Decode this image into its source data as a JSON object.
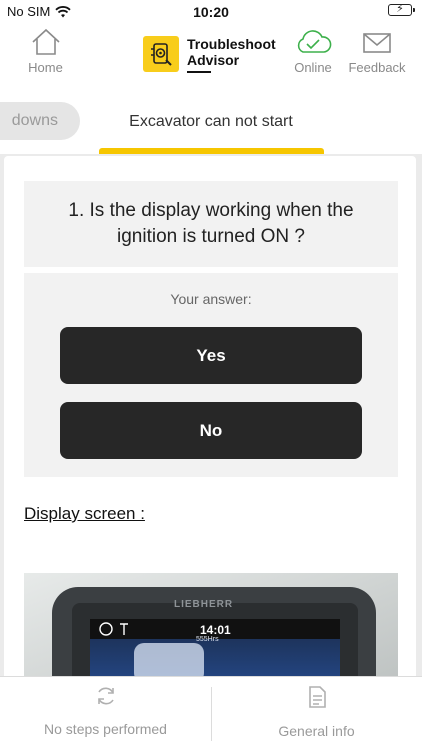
{
  "status_bar": {
    "carrier": "No SIM",
    "time": "10:20",
    "wifi_icon": "wifi-icon",
    "battery_icon": "battery-charging-icon"
  },
  "header": {
    "home_label": "Home",
    "home_icon": "home-icon",
    "logo_line1": "Troubleshoot",
    "logo_line2": "Advisor",
    "online_label": "Online",
    "online_icon": "cloud-check-icon",
    "feedback_label": "Feedback",
    "feedback_icon": "envelope-icon",
    "accent": "#f8cd1b"
  },
  "tabs": {
    "previous": "downs",
    "active": "Excavator can not start"
  },
  "question": {
    "text": "1. Is the display working when the ignition is turned ON ?"
  },
  "answers": {
    "prompt": "Your answer:",
    "options": [
      "Yes",
      "No"
    ]
  },
  "section": {
    "title": "Display screen :"
  },
  "photo": {
    "brand": "LIEBHERR",
    "clock": "14:01",
    "hours": "555Hrs"
  },
  "footer": {
    "left_label": "No steps performed",
    "left_icon": "refresh-icon",
    "right_label": "General info",
    "right_icon": "document-icon"
  }
}
